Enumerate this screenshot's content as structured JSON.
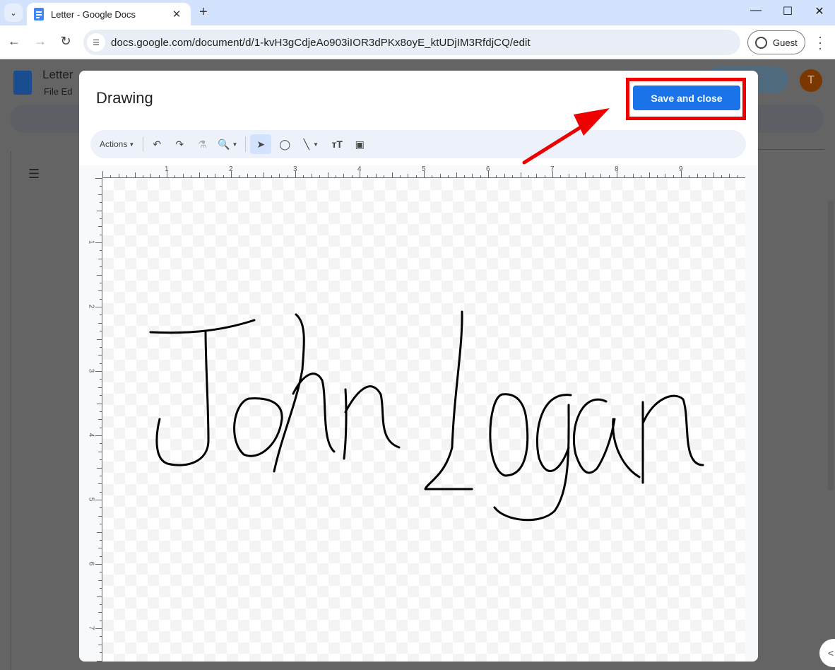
{
  "browser": {
    "tab_title": "Letter - Google Docs",
    "url": "docs.google.com/document/d/1-kvH3gCdjeAo903iIOR3dPKx8oyE_ktUDjIM3RfdjCQ/edit",
    "profile_label": "Guest"
  },
  "docs": {
    "title": "Letter",
    "menu": "File   Ed",
    "avatar_initial": "T"
  },
  "drawing": {
    "title": "Drawing",
    "save_label": "Save and close",
    "toolbar": {
      "actions_label": "Actions",
      "icons": [
        "undo-icon",
        "redo-icon",
        "paint-format-icon",
        "zoom-icon",
        "select-icon",
        "shape-icon",
        "line-icon",
        "text-box-icon",
        "image-icon"
      ]
    },
    "ruler_h_labels": [
      "1",
      "2",
      "3",
      "4",
      "5",
      "6",
      "7",
      "8",
      "9"
    ],
    "ruler_v_labels": [
      "1",
      "2",
      "3",
      "4",
      "5",
      "6",
      "7"
    ],
    "ink_text": "John Logan"
  },
  "annotation": {
    "highlight_color": "#ee0000",
    "accent_color": "#1a73e8"
  }
}
